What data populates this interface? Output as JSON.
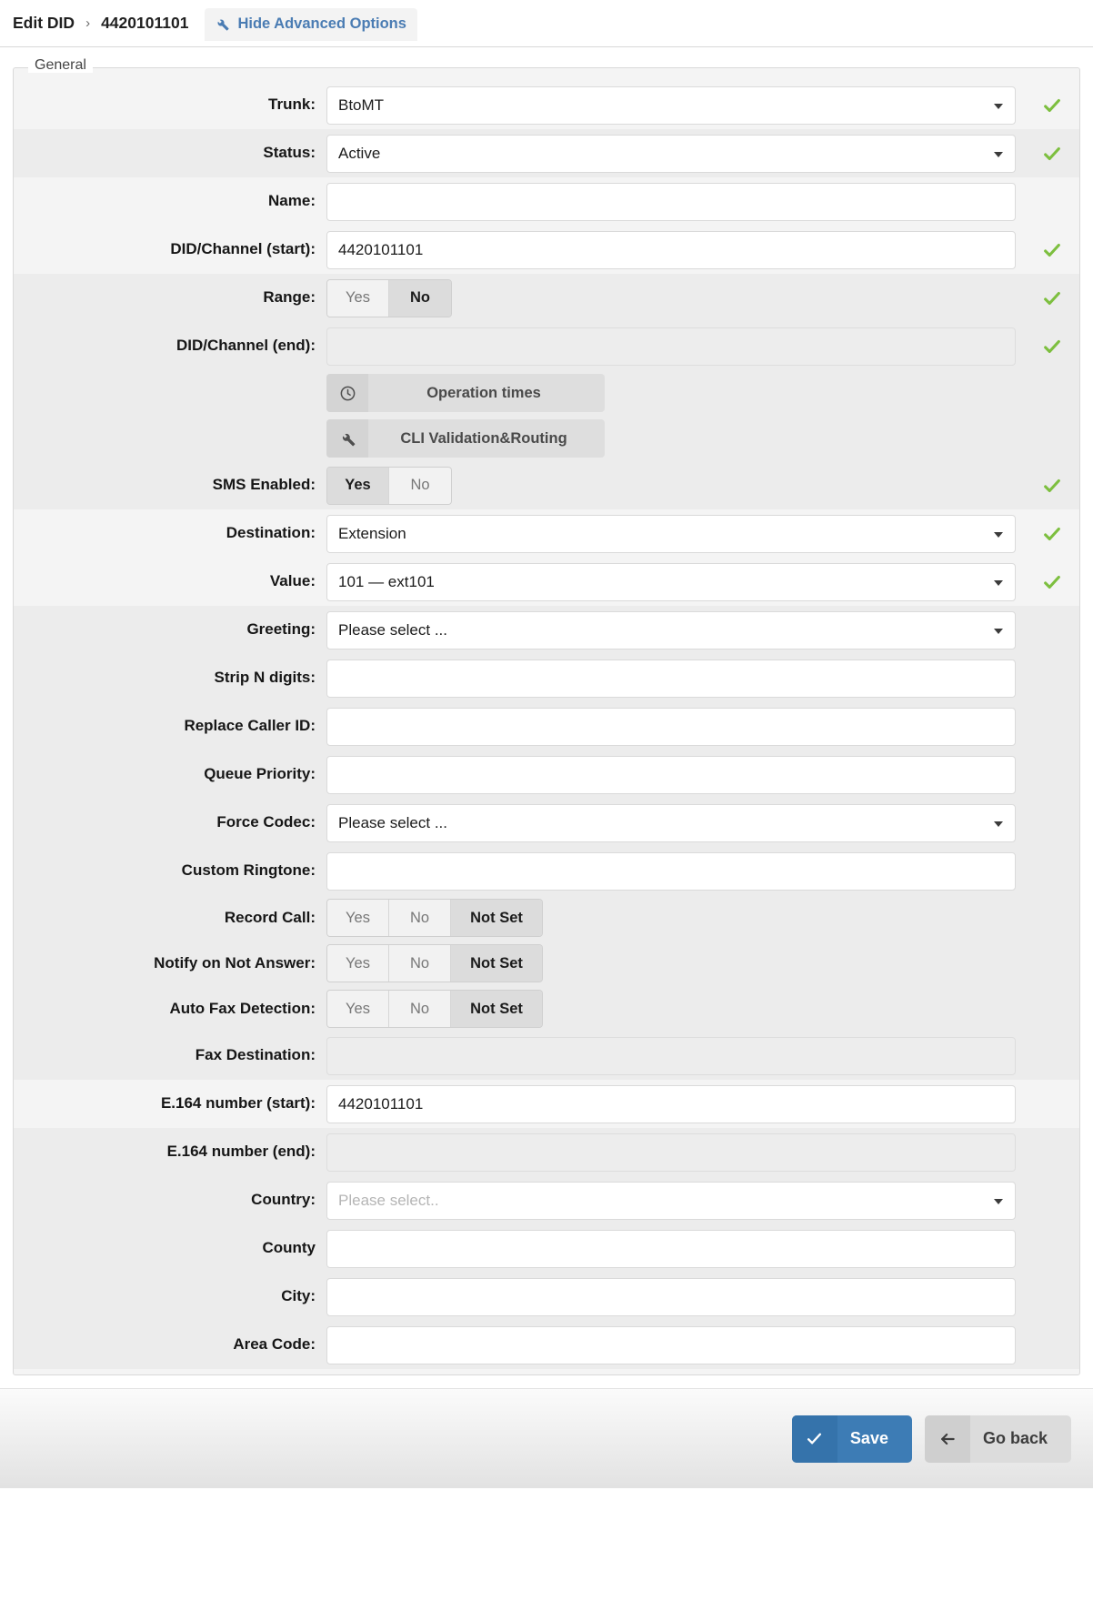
{
  "header": {
    "breadcrumb_root": "Edit DID",
    "breadcrumb_sep": "›",
    "breadcrumb_current": "4420101101",
    "advanced_toggle_label": "Hide Advanced Options",
    "advanced_toggle_icon": "wrench-icon",
    "link_color": "#4a7cb3"
  },
  "panel": {
    "legend": "General"
  },
  "fields": {
    "trunk": {
      "label": "Trunk:",
      "value": "BtoMT",
      "type": "select",
      "valid": true
    },
    "status": {
      "label": "Status:",
      "value": "Active",
      "type": "select",
      "valid": true
    },
    "name": {
      "label": "Name:",
      "value": "",
      "type": "text",
      "valid": false
    },
    "did_start": {
      "label": "DID/Channel (start):",
      "value": "4420101101",
      "type": "text",
      "valid": true
    },
    "range": {
      "label": "Range:",
      "options": [
        "Yes",
        "No"
      ],
      "selected": "No",
      "valid": true
    },
    "did_end": {
      "label": "DID/Channel (end):",
      "value": "",
      "type": "text",
      "disabled": true,
      "valid": true
    },
    "operation_times": {
      "label": "Operation times",
      "icon": "clock-icon"
    },
    "cli_validation": {
      "label": "CLI Validation&Routing",
      "icon": "wrench-icon"
    },
    "sms_enabled": {
      "label": "SMS Enabled:",
      "options": [
        "Yes",
        "No"
      ],
      "selected": "Yes",
      "valid": true
    },
    "destination": {
      "label": "Destination:",
      "value": "Extension",
      "type": "select",
      "valid": true
    },
    "value": {
      "label": "Value:",
      "value": "101  —  ext101",
      "type": "select",
      "valid": true
    },
    "greeting": {
      "label": "Greeting:",
      "value": "Please select ...",
      "type": "select",
      "valid": false
    },
    "strip_n_digits": {
      "label": "Strip N digits:",
      "value": "",
      "type": "text"
    },
    "replace_caller_id": {
      "label": "Replace Caller ID:",
      "value": "",
      "type": "text"
    },
    "queue_priority": {
      "label": "Queue Priority:",
      "value": "",
      "type": "text"
    },
    "force_codec": {
      "label": "Force Codec:",
      "value": "Please select ...",
      "type": "select"
    },
    "custom_ringtone": {
      "label": "Custom Ringtone:",
      "value": "",
      "type": "text"
    },
    "record_call": {
      "label": "Record Call:",
      "options": [
        "Yes",
        "No",
        "Not Set"
      ],
      "selected": "Not Set"
    },
    "notify_not_answer": {
      "label": "Notify on Not Answer:",
      "options": [
        "Yes",
        "No",
        "Not Set"
      ],
      "selected": "Not Set"
    },
    "auto_fax_detection": {
      "label": "Auto Fax Detection:",
      "options": [
        "Yes",
        "No",
        "Not Set"
      ],
      "selected": "Not Set"
    },
    "fax_destination": {
      "label": "Fax Destination:",
      "value": "",
      "type": "text",
      "disabled": true
    },
    "e164_start": {
      "label": "E.164 number (start):",
      "value": "4420101101",
      "type": "text"
    },
    "e164_end": {
      "label": "E.164 number (end):",
      "value": "",
      "type": "text",
      "disabled": true
    },
    "country": {
      "label": "Country:",
      "value": "",
      "placeholder": "Please select..",
      "type": "select"
    },
    "county": {
      "label": "County",
      "value": "",
      "type": "text"
    },
    "city": {
      "label": "City:",
      "value": "",
      "type": "text"
    },
    "area_code": {
      "label": "Area Code:",
      "value": "",
      "type": "text"
    }
  },
  "footer": {
    "save_label": "Save",
    "save_icon": "check-icon",
    "goback_label": "Go back",
    "goback_icon": "arrow-left-icon",
    "save_color": "#3d7cb5"
  },
  "colors": {
    "valid_check": "#7dbf3f",
    "band_light": "#f4f4f4",
    "band_dark": "#ececec"
  }
}
